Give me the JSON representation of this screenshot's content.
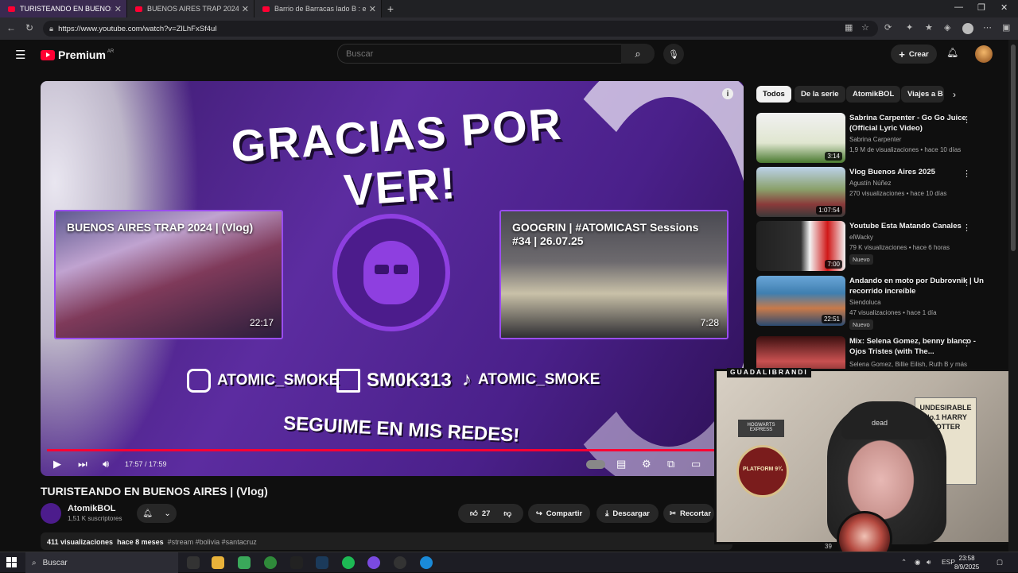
{
  "browser": {
    "tabs": [
      {
        "title": "TURISTEANDO EN BUENOS AIRES |",
        "active": true
      },
      {
        "title": "BUENOS AIRES TRAP 2024 | (Vlog)",
        "active": false
      },
      {
        "title": "Barrio de Barracas lado B : en las c",
        "active": false
      }
    ],
    "new_tab": "+",
    "url": "https://www.youtube.com/watch?v=ZlLhFxSf4uI"
  },
  "header": {
    "logo_text": "Premium",
    "region": "AR",
    "search_placeholder": "Buscar",
    "create_label": "Crear"
  },
  "player": {
    "end_title": "GRACIAS POR VER!",
    "end_cards": [
      {
        "title": "BUENOS AIRES TRAP 2024 | (Vlog)",
        "duration": "22:17"
      },
      {
        "title": "GOOGRIN | #ATOMICAST Sessions #34 | 26.07.25",
        "duration": "7:28"
      }
    ],
    "socials": [
      {
        "icon": "instagram-icon",
        "handle": "ATOMIC_SMOKE"
      },
      {
        "icon": "twitch-icon",
        "handle": "SM0K313"
      },
      {
        "icon": "tiktok-icon",
        "handle": "ATOMIC_SMOKE"
      }
    ],
    "tagline": "SEGUIME EN MIS REDES!",
    "time": "17:57 / 17:59",
    "progress": 0.998
  },
  "video": {
    "title": "TURISTEANDO EN BUENOS AIRES | (Vlog)",
    "channel": "AtomikBOL",
    "subscribers": "1,51 K suscriptores",
    "likes": "27",
    "share_label": "Compartir",
    "download_label": "Descargar",
    "clip_label": "Recortar",
    "views": "411 visualizaciones",
    "age": "hace 8 meses",
    "tags": "#stream #bolivia #santacruz"
  },
  "chips": [
    "Todos",
    "De la serie",
    "AtomikBOL",
    "Viajes a B"
  ],
  "recommendations": [
    {
      "title": "Sabrina Carpenter - Go Go Juice (Official Lyric Video)",
      "channel": "Sabrina Carpenter",
      "meta": "1,9 M de visualizaciones • hace 10 días",
      "duration": "3:14",
      "badge": ""
    },
    {
      "title": "Vlog Buenos Aires 2025",
      "channel": "Agustín Núñez",
      "meta": "270 visualizaciones • hace 10 días",
      "duration": "1:07:54",
      "badge": ""
    },
    {
      "title": "Youtube Esta Matando Canales",
      "channel": "elWacky",
      "meta": "79 K visualizaciones • hace 6 horas",
      "duration": "7:00",
      "badge": "Nuevo"
    },
    {
      "title": "Andando en moto por Dubrovnik | Un recorrido increíble",
      "channel": "Siendoluca",
      "meta": "47 visualizaciones • hace 1 día",
      "duration": "22:51",
      "badge": "Nuevo"
    },
    {
      "title": "Mix: Selena Gomez, benny blanco - Ojos Tristes (with The...",
      "channel": "Selena Gomez, Billie Eilish, Ruth B y más",
      "meta": "",
      "duration": "",
      "badge": ""
    }
  ],
  "overlay": {
    "label": "GUADALIBRANDI",
    "poster": "UNDESIRABLE No.1 HARRY POTTER",
    "platform": "PLATFORM 9¾",
    "sign": "HOGWARTS EXPRESS",
    "beanie": "dead",
    "count": "39"
  },
  "taskbar": {
    "search_placeholder": "Buscar",
    "lang": "ESP",
    "time": "23:58",
    "date": "8/9/2025"
  },
  "colors": {
    "accent": "#ff0033",
    "purple": "#5c2ca0"
  }
}
